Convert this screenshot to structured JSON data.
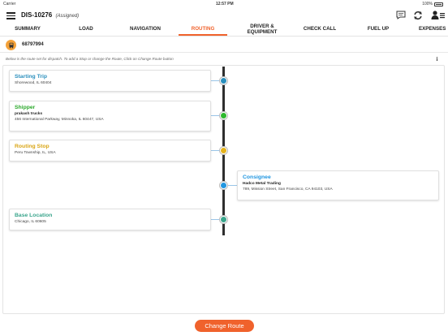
{
  "status_bar": {
    "carrier": "Carrier",
    "time": "12:57 PM",
    "battery": "100%"
  },
  "header": {
    "dispatch_id": "DIS-10276",
    "dispatch_status": "(Assigned)",
    "icons": [
      "menu-icon",
      "chat-icon",
      "refresh-icon",
      "user-menu-icon"
    ]
  },
  "tabs": [
    {
      "label": "SUMMARY"
    },
    {
      "label": "LOAD"
    },
    {
      "label": "NAVIGATION"
    },
    {
      "label": "ROUTING",
      "active": true
    },
    {
      "label": "DRIVER &\nEQUIPMENT"
    },
    {
      "label": "CHECK CALL"
    },
    {
      "label": "FUEL UP"
    },
    {
      "label": "EXPENSES"
    }
  ],
  "truck": {
    "icon": "truck-icon",
    "number": "68797994"
  },
  "info": {
    "text": "Below is the route set for dispatch. To add a Stop or change the Route, Click on Change Route button",
    "icon": "info-icon"
  },
  "stops": [
    {
      "title": "Starting Trip",
      "subtitle": "",
      "address": "Shorewood, IL 60404",
      "color": "#2a8fbd",
      "node_color": "#2a8fbd",
      "side": "left"
    },
    {
      "title": "Shipper",
      "subtitle": "prakash trucks",
      "address": "456 International Parkway, Minnoka, IL 60447, USA",
      "color": "#2aa82a",
      "node_color": "#2db82d",
      "side": "left"
    },
    {
      "title": "Routing Stop",
      "subtitle": "",
      "address": "Peru Township, IL, USA",
      "color": "#d9a514",
      "node_color": "#e5b31c",
      "side": "left"
    },
    {
      "title": "Consignee",
      "subtitle": "Hadco Metal Trading",
      "address": "789, Mission Street, San Francisco, CA 94103, USA",
      "color": "#2196e0",
      "node_color": "#2196e0",
      "side": "right"
    },
    {
      "title": "Base Location",
      "subtitle": "",
      "address": "Chicago, IL 60605",
      "color": "#3aa58c",
      "node_color": "#3aa58c",
      "side": "left"
    }
  ],
  "footer": {
    "button_label": "Change Route"
  },
  "colors": {
    "accent": "#f0622c",
    "timeline": "#2e2e2e"
  }
}
